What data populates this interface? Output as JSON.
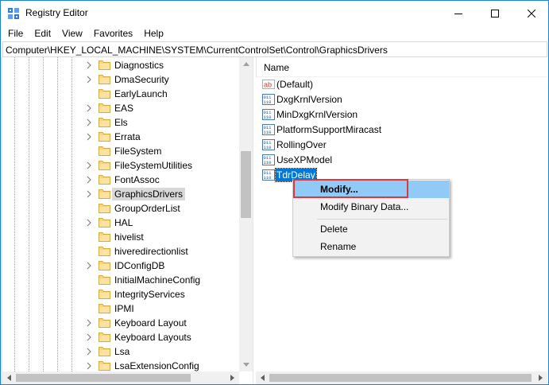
{
  "window": {
    "title": "Registry Editor",
    "accent_color": "#1883d7"
  },
  "menu": [
    "File",
    "Edit",
    "View",
    "Favorites",
    "Help"
  ],
  "address": "Computer\\HKEY_LOCAL_MACHINE\\SYSTEM\\CurrentControlSet\\Control\\GraphicsDrivers",
  "tree": {
    "items": [
      {
        "label": "Diagnostics",
        "expandable": true,
        "selected": false
      },
      {
        "label": "DmaSecurity",
        "expandable": true,
        "selected": false
      },
      {
        "label": "EarlyLaunch",
        "expandable": false,
        "selected": false
      },
      {
        "label": "EAS",
        "expandable": true,
        "selected": false
      },
      {
        "label": "Els",
        "expandable": true,
        "selected": false
      },
      {
        "label": "Errata",
        "expandable": true,
        "selected": false
      },
      {
        "label": "FileSystem",
        "expandable": false,
        "selected": false
      },
      {
        "label": "FileSystemUtilities",
        "expandable": true,
        "selected": false
      },
      {
        "label": "FontAssoc",
        "expandable": true,
        "selected": false
      },
      {
        "label": "GraphicsDrivers",
        "expandable": true,
        "selected": true
      },
      {
        "label": "GroupOrderList",
        "expandable": false,
        "selected": false
      },
      {
        "label": "HAL",
        "expandable": true,
        "selected": false
      },
      {
        "label": "hivelist",
        "expandable": false,
        "selected": false
      },
      {
        "label": "hiveredirectionlist",
        "expandable": false,
        "selected": false
      },
      {
        "label": "IDConfigDB",
        "expandable": true,
        "selected": false
      },
      {
        "label": "InitialMachineConfig",
        "expandable": false,
        "selected": false
      },
      {
        "label": "IntegrityServices",
        "expandable": false,
        "selected": false
      },
      {
        "label": "IPMI",
        "expandable": false,
        "selected": false
      },
      {
        "label": "Keyboard Layout",
        "expandable": true,
        "selected": false
      },
      {
        "label": "Keyboard Layouts",
        "expandable": true,
        "selected": false
      },
      {
        "label": "Lsa",
        "expandable": true,
        "selected": false
      },
      {
        "label": "LsaExtensionConfig",
        "expandable": true,
        "selected": false
      }
    ]
  },
  "values": {
    "column_name": "Name",
    "items": [
      {
        "label": "(Default)",
        "type": "string",
        "highlighted": false
      },
      {
        "label": "DxgKrnlVersion",
        "type": "binary",
        "highlighted": false
      },
      {
        "label": "MinDxgKrnlVersion",
        "type": "binary",
        "highlighted": false
      },
      {
        "label": "PlatformSupportMiracast",
        "type": "binary",
        "highlighted": false
      },
      {
        "label": "RollingOver",
        "type": "binary",
        "highlighted": false
      },
      {
        "label": "UseXPModel",
        "type": "binary",
        "highlighted": false
      },
      {
        "label": "TdrDelay",
        "type": "binary",
        "highlighted": true
      }
    ]
  },
  "context_menu": {
    "modify": "Modify...",
    "modify_binary": "Modify Binary Data...",
    "delete": "Delete",
    "rename": "Rename",
    "hover_color": "#91c9f7",
    "callout_color": "#e0383a"
  }
}
